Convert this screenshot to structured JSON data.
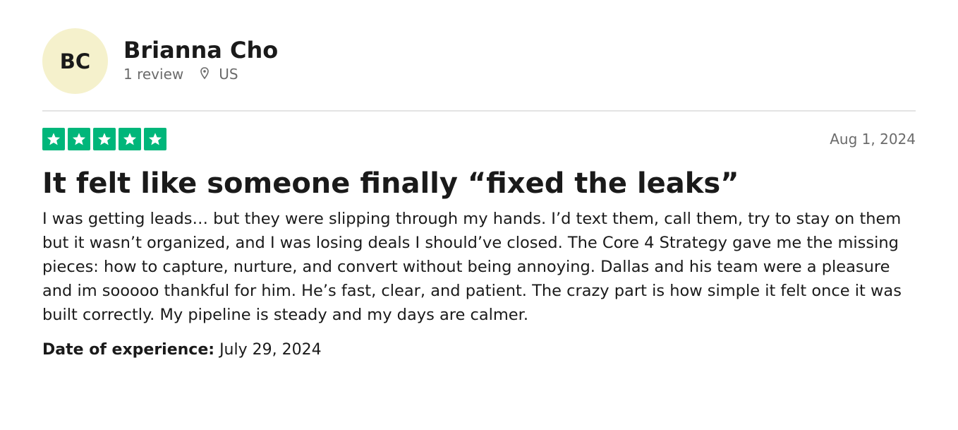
{
  "reviewer": {
    "initials": "BC",
    "name": "Brianna Cho",
    "review_count": "1 review",
    "country": "US",
    "avatar_color": "#f5f1cc"
  },
  "review": {
    "rating": 5,
    "max_rating": 5,
    "star_color": "#00b67a",
    "date": "Aug 1, 2024",
    "title": "It felt like someone finally “fixed the leaks”",
    "body": "I was getting leads… but they were slipping through my hands. I’d text them, call them, try to stay on them but it wasn’t organized, and I was losing deals I should’ve closed. The Core 4 Strategy gave me the missing pieces: how to capture, nurture, and convert without being annoying. Dallas and his team were a pleasure and im sooooo thankful for him. He’s fast, clear, and patient. The crazy part is how simple it felt once it was built correctly. My pipeline is steady and my days are calmer.",
    "experience_label": "Date of experience:",
    "experience_date": "July 29, 2024"
  },
  "icons": {
    "location": "location-pin-icon",
    "star": "star-icon"
  }
}
